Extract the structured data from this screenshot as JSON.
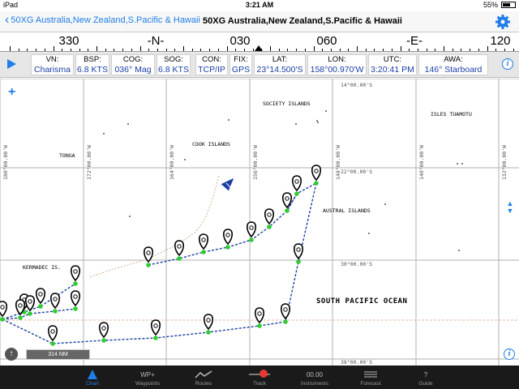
{
  "status_bar": {
    "device": "iPad",
    "wifi_icon": "wifi-icon",
    "time": "3:21 AM",
    "battery_percent": "55%",
    "battery_level": 0.55
  },
  "nav": {
    "back_label": "50XG Australia,New Zealand,S.Pacific & Hawaii",
    "title": "50XG Australia,New Zealand,S.Pacific & Hawaii",
    "settings_icon": "gear-icon",
    "accent_color": "#1f7ee8"
  },
  "compass": {
    "labels": [
      "330",
      "-N-",
      "030",
      "060",
      "-E-",
      "120"
    ]
  },
  "instruments": [
    {
      "label": "VN:",
      "value": "Charisma"
    },
    {
      "label": "BSP:",
      "value": "6.8 KTS"
    },
    {
      "label": "COG:",
      "value": "036° Mag"
    },
    {
      "label": "SOG:",
      "value": "6.8 KTS"
    },
    {
      "label": "CON:",
      "value": "TCP/IP"
    },
    {
      "label": "FIX:",
      "value": "GPS"
    },
    {
      "label": "LAT:",
      "value": "23°14.500'S"
    },
    {
      "label": "LON:",
      "value": "158°00.970'W"
    },
    {
      "label": "UTC:",
      "value": "3:20:41 PM"
    },
    {
      "label": "AWA:",
      "value": "146° Starboard"
    }
  ],
  "map": {
    "labels": {
      "society": "SOCIETY ISLANDS",
      "tuamotu": "ISLES TUAMOTU",
      "tonga": "TONGA",
      "cook": "COOK ISLANDS",
      "austral": "AUSTRAL ISLANDS",
      "kermadec": "KERMADEC IS.",
      "ocean": "SOUTH PACIFIC OCEAN"
    },
    "lat_labels": [
      "14°00.00'S",
      "22°00.00'S",
      "30°00.00'S",
      "38°00.00'S"
    ],
    "lon_labels": [
      "180°00.00'W",
      "172°00.00'W",
      "164°00.00'W",
      "156°00.00'W",
      "148°00.00'W",
      "140°00.00'W",
      "132°00.00'W"
    ],
    "scale_label": "314 NM",
    "zoom_in_label": "+",
    "route_color": "#1b3fa3",
    "waypoint_color": "#2ecc2e"
  },
  "tabs": [
    {
      "label": "Chart",
      "icon": "chart-icon",
      "active": true
    },
    {
      "label": "Waypoints",
      "icon": "waypoints-icon",
      "glyph": "WP+"
    },
    {
      "label": "Routes",
      "icon": "routes-icon"
    },
    {
      "label": "Track",
      "icon": "track-icon"
    },
    {
      "label": "Instruments",
      "icon": "instruments-icon",
      "glyph": "00.00"
    },
    {
      "label": "Forecast",
      "icon": "forecast-icon"
    },
    {
      "label": "Guide",
      "icon": "guide-icon",
      "glyph": "?"
    }
  ]
}
